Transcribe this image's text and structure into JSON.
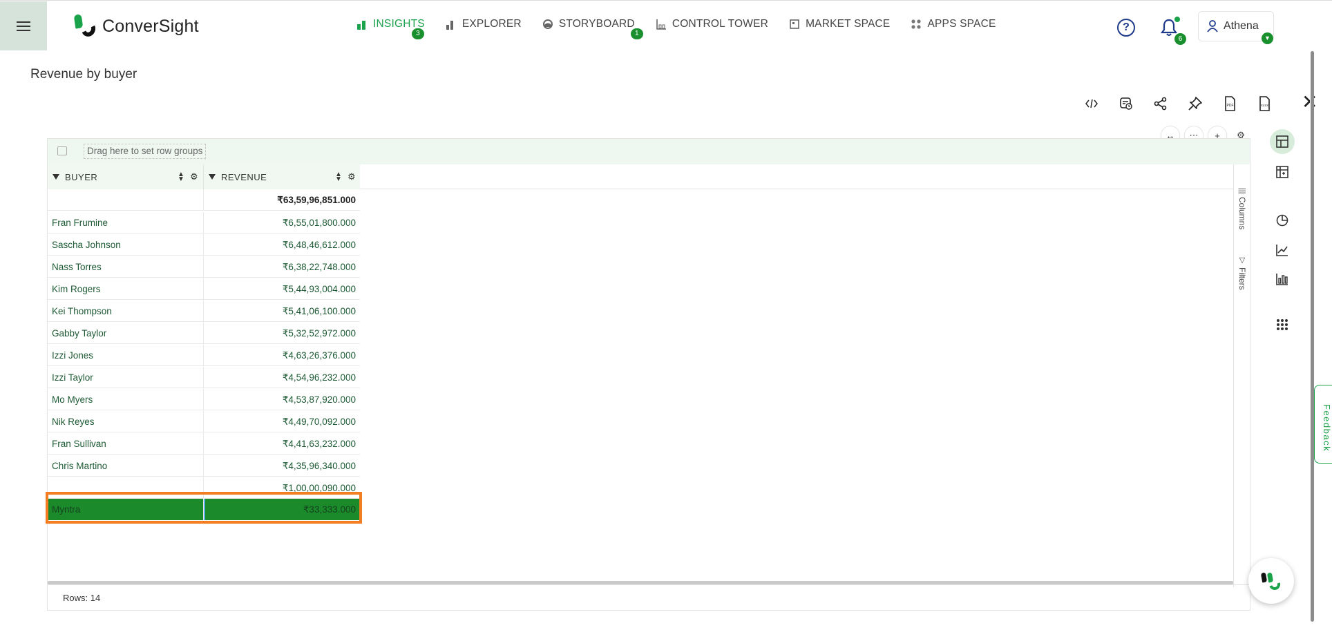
{
  "app": {
    "brand": "ConverSight"
  },
  "nav": [
    {
      "label": "INSIGHTS",
      "active": true,
      "badge": "3"
    },
    {
      "label": "EXPLORER",
      "active": false,
      "badge": ""
    },
    {
      "label": "STORYBOARD",
      "active": false,
      "badge": "1"
    },
    {
      "label": "CONTROL TOWER",
      "active": false,
      "badge": ""
    },
    {
      "label": "MARKET SPACE",
      "active": false,
      "badge": ""
    },
    {
      "label": "APPS SPACE",
      "active": false,
      "badge": ""
    }
  ],
  "header": {
    "help_icon": "question-circle-icon",
    "notifications_count": "6",
    "user_name": "Athena"
  },
  "page": {
    "title": "Revenue by buyer"
  },
  "toolbar": {
    "icons": [
      "code-icon",
      "schedule-report-icon",
      "share-icon",
      "pin-icon",
      "pdf-export-icon",
      "xlsx-export-icon",
      "close-icon"
    ],
    "pdf_label": "PDF",
    "xlsx_label": "XLSX"
  },
  "grid": {
    "group_bar_text": "Drag here to set row groups",
    "columns": [
      "BUYER",
      "REVENUE"
    ],
    "total_row": {
      "buyer": "",
      "revenue": "₹63,59,96,851.000"
    },
    "rows": [
      {
        "buyer": "Fran Frumine",
        "revenue": "₹6,55,01,800.000"
      },
      {
        "buyer": "Sascha Johnson",
        "revenue": "₹6,48,46,612.000"
      },
      {
        "buyer": "Nass Torres",
        "revenue": "₹6,38,22,748.000"
      },
      {
        "buyer": "Kim Rogers",
        "revenue": "₹5,44,93,004.000"
      },
      {
        "buyer": "Kei Thompson",
        "revenue": "₹5,41,06,100.000"
      },
      {
        "buyer": "Gabby Taylor",
        "revenue": "₹5,32,52,972.000"
      },
      {
        "buyer": "Izzi Jones",
        "revenue": "₹4,63,26,376.000"
      },
      {
        "buyer": "Izzi Taylor",
        "revenue": "₹4,54,96,232.000"
      },
      {
        "buyer": "Mo Myers",
        "revenue": "₹4,53,87,920.000"
      },
      {
        "buyer": "Nik Reyes",
        "revenue": "₹4,49,70,092.000"
      },
      {
        "buyer": "Fran Sullivan",
        "revenue": "₹4,41,63,232.000"
      },
      {
        "buyer": "Chris Martino",
        "revenue": "₹4,35,96,340.000"
      },
      {
        "buyer": "",
        "revenue": "₹1,00,00,090.000"
      },
      {
        "buyer": "Myntra",
        "revenue": "₹33,333.000",
        "selected": true
      }
    ],
    "side_tabs": [
      "Columns",
      "Filters"
    ],
    "status": "Rows: 14"
  },
  "right_toolbar": [
    "table-view-icon",
    "pivot-table-icon",
    "pie-chart-icon",
    "line-chart-icon",
    "bar-chart-icon",
    "more-charts-grid-icon"
  ],
  "feedback_label": "Feedback",
  "colors": {
    "accent": "#1aa34a",
    "selection_fill": "#1b8a2a",
    "selection_outline": "#f47c21",
    "header_bg": "#f1f8f2"
  }
}
